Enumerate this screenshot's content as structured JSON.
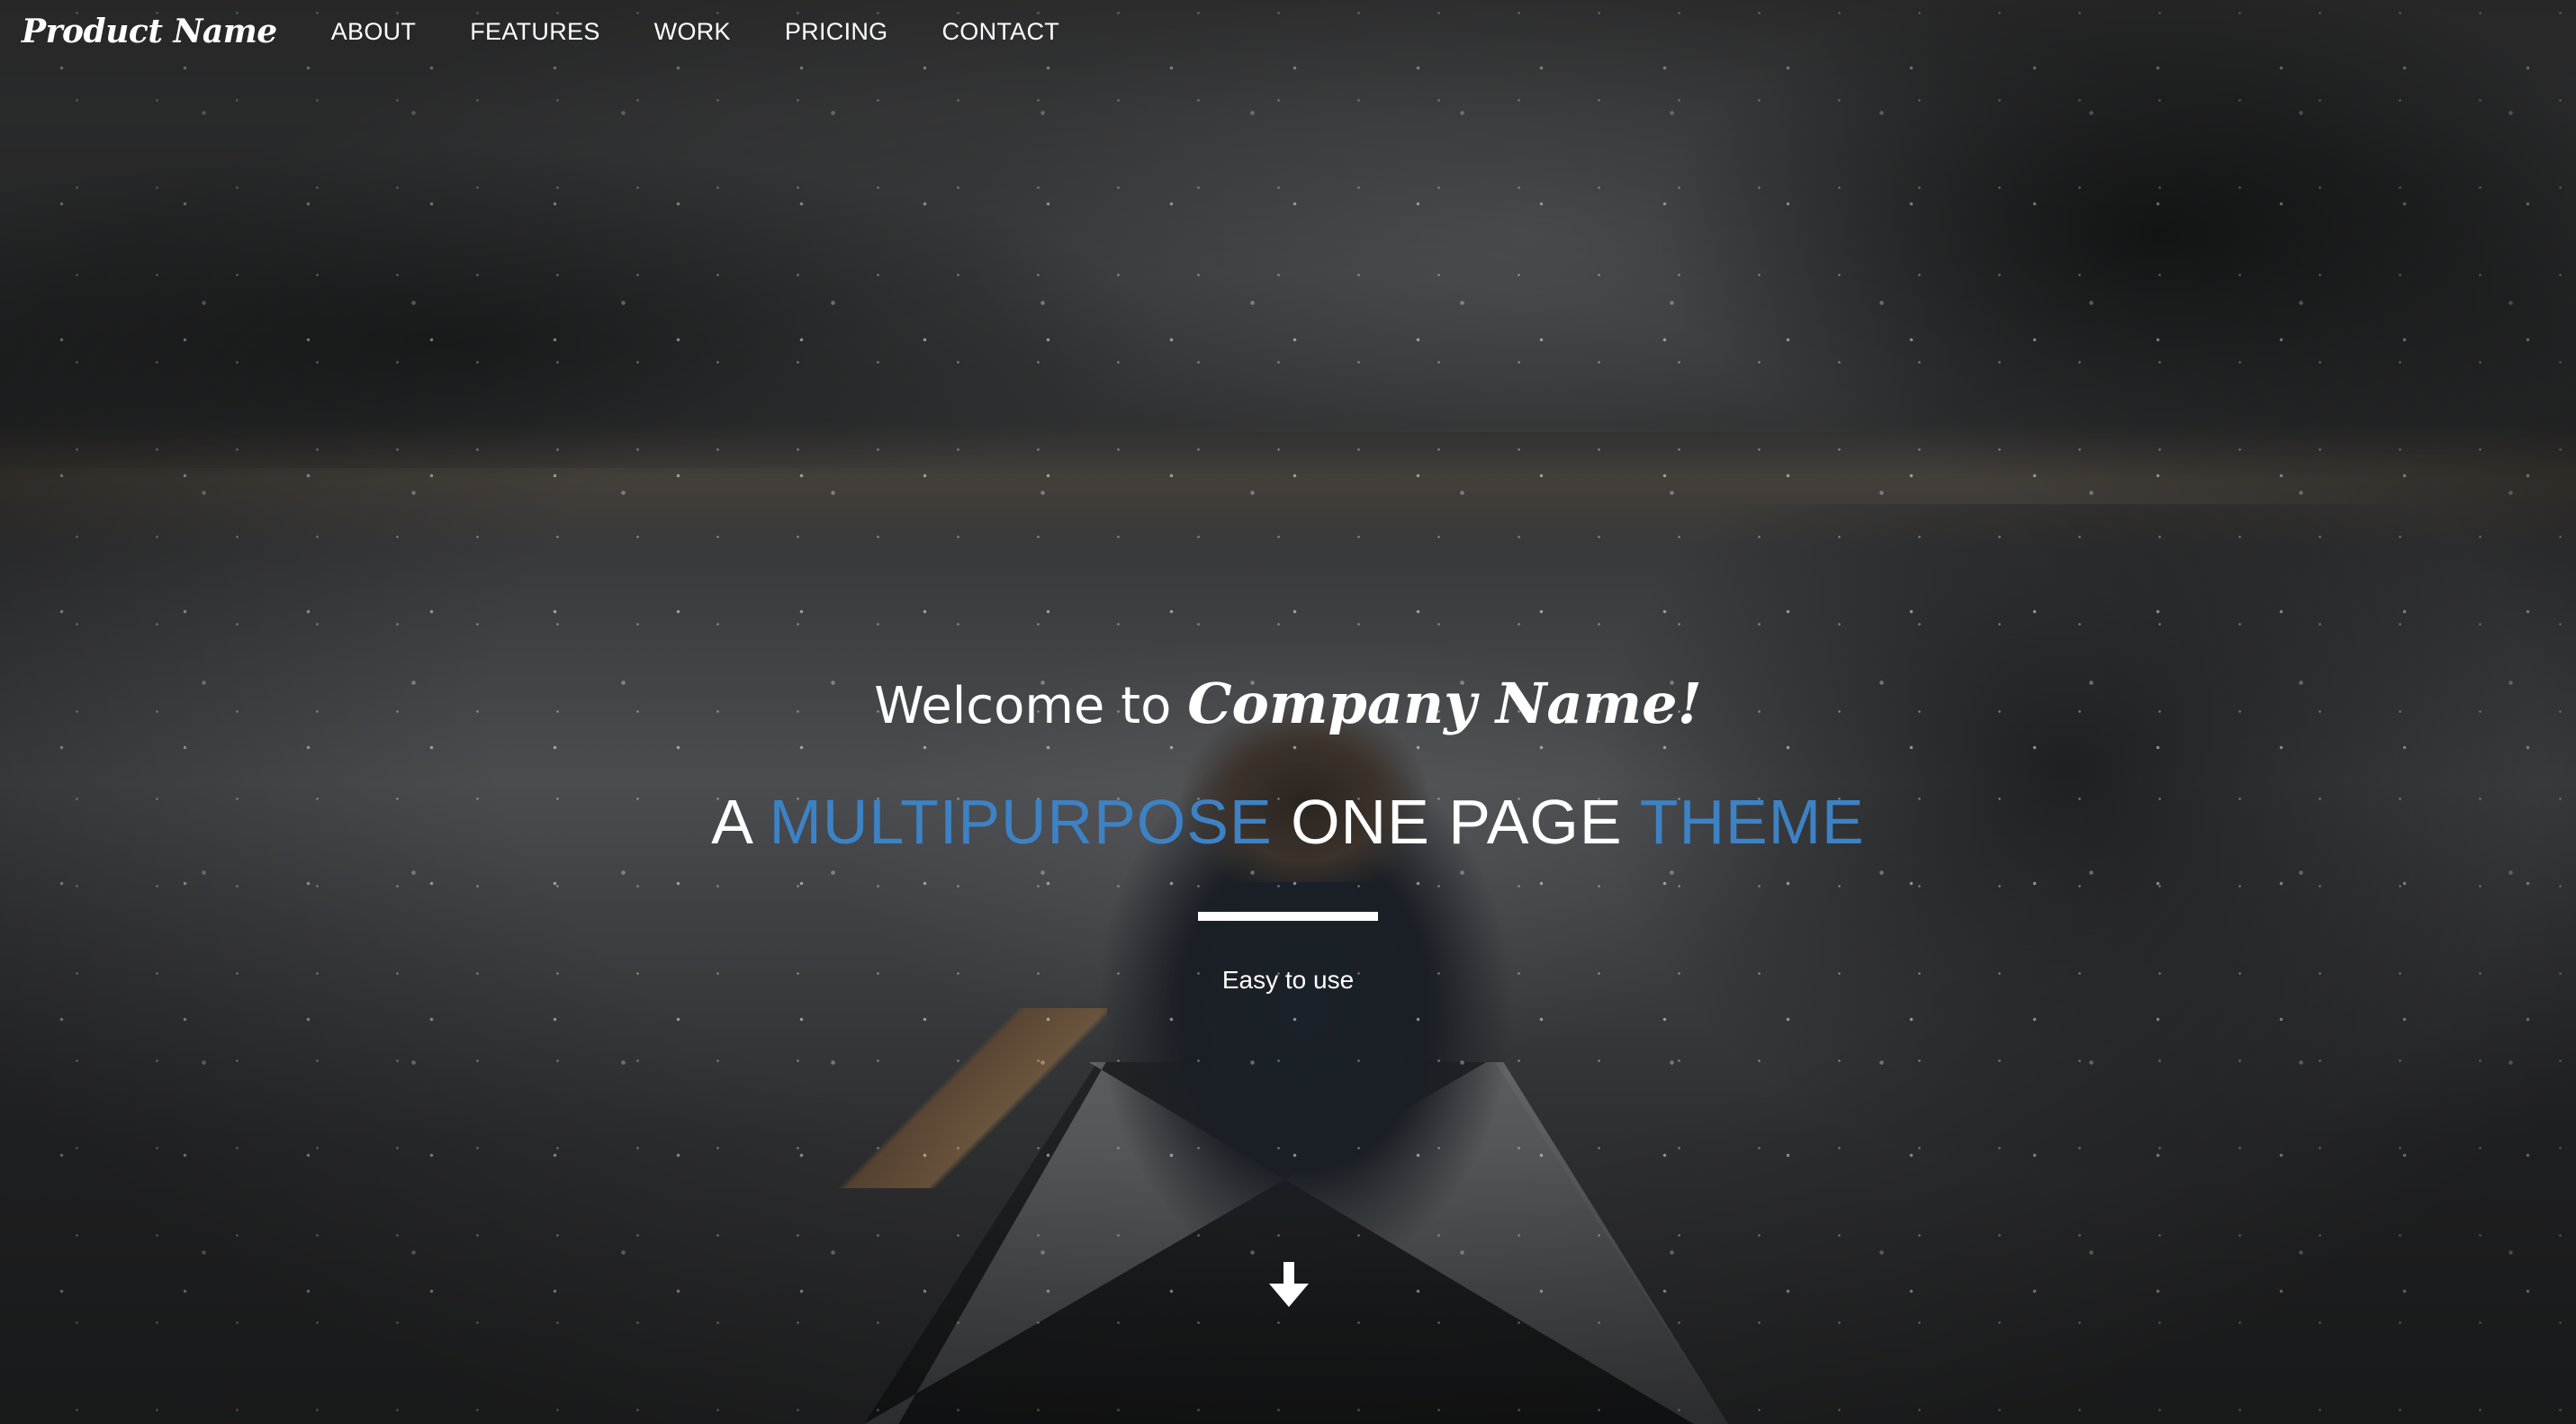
{
  "navbar": {
    "brand": "Product Name",
    "links": [
      {
        "label": "ABOUT"
      },
      {
        "label": "FEATURES"
      },
      {
        "label": "WORK"
      },
      {
        "label": "PRICING"
      },
      {
        "label": "CONTACT"
      }
    ]
  },
  "hero": {
    "welcome_prefix": "Welcome to",
    "company_name": "Company Name!",
    "tagline": {
      "word1": "A",
      "word2": "MULTIPURPOSE",
      "word3": "ONE PAGE",
      "word4": "THEME"
    },
    "subtitle": "Easy to use",
    "scroll_icon": "arrow-down-icon"
  },
  "colors": {
    "accent": "#3d82c4",
    "text": "#ffffff"
  }
}
